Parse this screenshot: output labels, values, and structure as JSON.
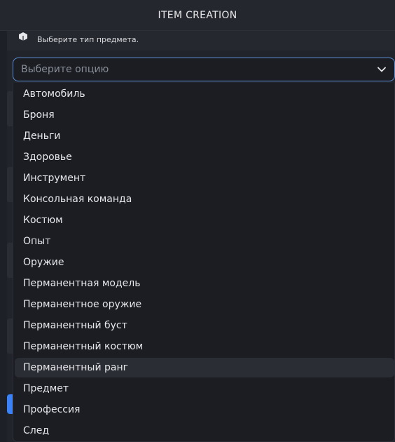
{
  "window": {
    "title": "ITEM CREATION"
  },
  "section": {
    "type_caption": "Выберите тип предмета."
  },
  "select": {
    "placeholder": "Выберите опцию"
  },
  "options": [
    "Автомобиль",
    "Броня",
    "Деньги",
    "Здоровье",
    "Инструмент",
    "Консольная команда",
    "Костюм",
    "Опыт",
    "Оружие",
    "Перманентная модель",
    "Перманентное оружие",
    "Перманентный буст",
    "Перманентный костюм",
    "Перманентный ранг",
    "Предмет",
    "Профессия",
    "След"
  ],
  "highlighted_option": "Перманентный ранг",
  "colors": {
    "accent": "#3b82f6",
    "focus_border": "#5b8fd6"
  },
  "icons": {
    "select_chevron": "chevron-down-icon",
    "section_icon": "cube-icon"
  }
}
